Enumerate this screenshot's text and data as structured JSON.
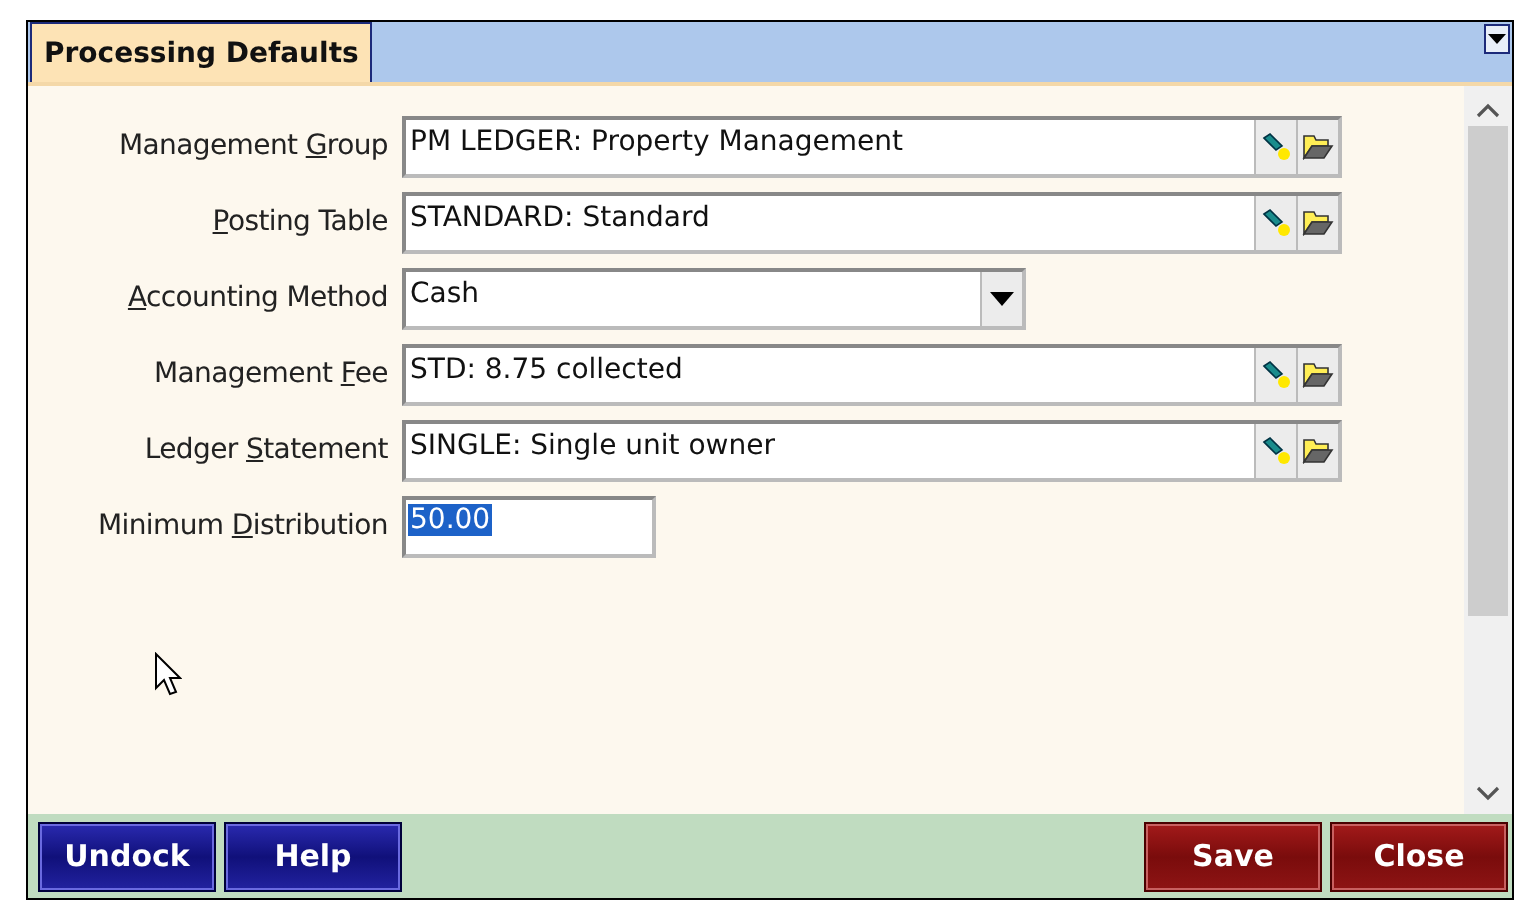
{
  "tab": {
    "label": "Processing Defaults",
    "selected": true
  },
  "fields": [
    {
      "label_before": "Management ",
      "access_key": "G",
      "label_after": "roup",
      "kind": "lookup",
      "value": "PM LEDGER: Property Management"
    },
    {
      "access_key": "P",
      "label_after": "osting Table",
      "kind": "lookup",
      "value": "STANDARD: Standard"
    },
    {
      "access_key": "A",
      "label_after": "ccounting Method",
      "kind": "select",
      "value": "Cash"
    },
    {
      "label_before": "Management ",
      "access_key": "F",
      "label_after": "ee",
      "kind": "lookup",
      "value": "STD: 8.75 collected"
    },
    {
      "label_before": "Ledger ",
      "access_key": "S",
      "label_after": "tatement",
      "kind": "lookup",
      "value": "SINGLE: Single unit owner"
    },
    {
      "label_before": "Minimum ",
      "access_key": "D",
      "label_after": "istribution",
      "kind": "text",
      "value": "50.00",
      "selected": true
    }
  ],
  "buttons": [
    {
      "label": "Undock",
      "kind": "primary"
    },
    {
      "label": "Help",
      "kind": "primary"
    },
    {
      "label": "Save",
      "kind": "danger"
    },
    {
      "label": "Close",
      "kind": "danger"
    }
  ]
}
